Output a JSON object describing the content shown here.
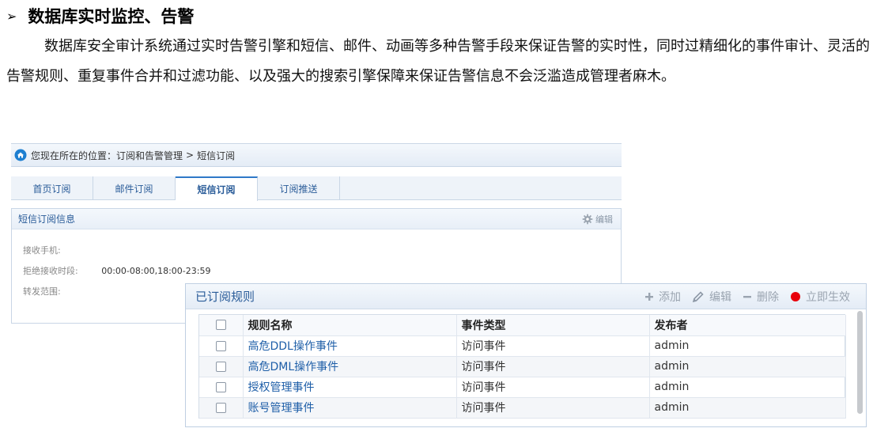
{
  "document": {
    "bullet": "➢",
    "heading": "数据库实时监控、告警",
    "paragraph": "数据库安全审计系统通过实时告警引擎和短信、邮件、动画等多种告警手段来保证告警的实时性，同时过精细化的事件审计、灵活的告警规则、重复事件合并和过滤功能、以及强大的搜索引擎保障来保证告警信息不会泛滥造成管理者麻木。"
  },
  "breadcrumb": {
    "prefix": "您现在所在的位置：",
    "parent": "订阅和告警管理",
    "separator": ">",
    "current": "短信订阅"
  },
  "tabs": [
    {
      "label": "首页订阅",
      "active": false
    },
    {
      "label": "邮件订阅",
      "active": false
    },
    {
      "label": "短信订阅",
      "active": true
    },
    {
      "label": "订阅推送",
      "active": false
    }
  ],
  "sms_info": {
    "title": "短信订阅信息",
    "edit_label": "编辑",
    "phone_label": "接收手机:",
    "phone_value": "",
    "reject_label": "拒绝接收时段:",
    "reject_value": "00:00-08:00,18:00-23:59",
    "forward_label": "转发范围:",
    "forward_value": ""
  },
  "rules": {
    "title": "已订阅规则",
    "toolbar": {
      "add": "添加",
      "edit": "编辑",
      "delete": "删除",
      "apply": "立即生效"
    },
    "columns": [
      "规则名称",
      "事件类型",
      "发布者"
    ],
    "rows": [
      {
        "name": "高危DDL操作事件",
        "type": "访问事件",
        "publisher": "admin"
      },
      {
        "name": "高危DML操作事件",
        "type": "访问事件",
        "publisher": "admin"
      },
      {
        "name": "授权管理事件",
        "type": "访问事件",
        "publisher": "admin"
      },
      {
        "name": "账号管理事件",
        "type": "访问事件",
        "publisher": "admin"
      }
    ]
  },
  "colors": {
    "accent_blue": "#2a5c99",
    "link_blue": "#1f5fa8",
    "apply_red": "#e8000b",
    "home_icon_blue": "#1d7fd1"
  }
}
